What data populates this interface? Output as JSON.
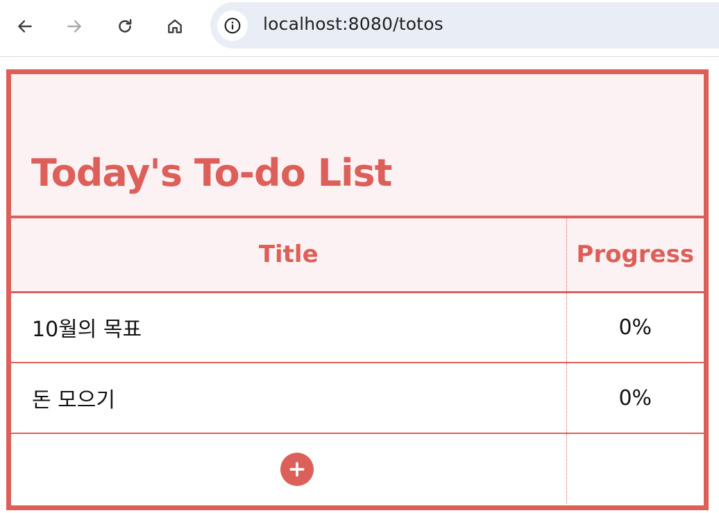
{
  "browser": {
    "url": "localhost:8080/totos",
    "icons": {
      "back": "arrow-left-icon",
      "forward": "arrow-right-icon",
      "reload": "reload-icon",
      "home": "home-icon",
      "site_info": "info-icon"
    }
  },
  "todo": {
    "title": "Today's To-do List",
    "columns": {
      "title": "Title",
      "progress": "Progress"
    },
    "items": [
      {
        "title": "10월의 목표",
        "progress": "0%"
      },
      {
        "title": "돈 모으기",
        "progress": "0%"
      }
    ],
    "add_icon": "plus-circle-icon"
  },
  "colors": {
    "accent": "#dd5f5a",
    "header_bg": "#fdf2f3",
    "omnibox_bg": "#e9edf5"
  }
}
